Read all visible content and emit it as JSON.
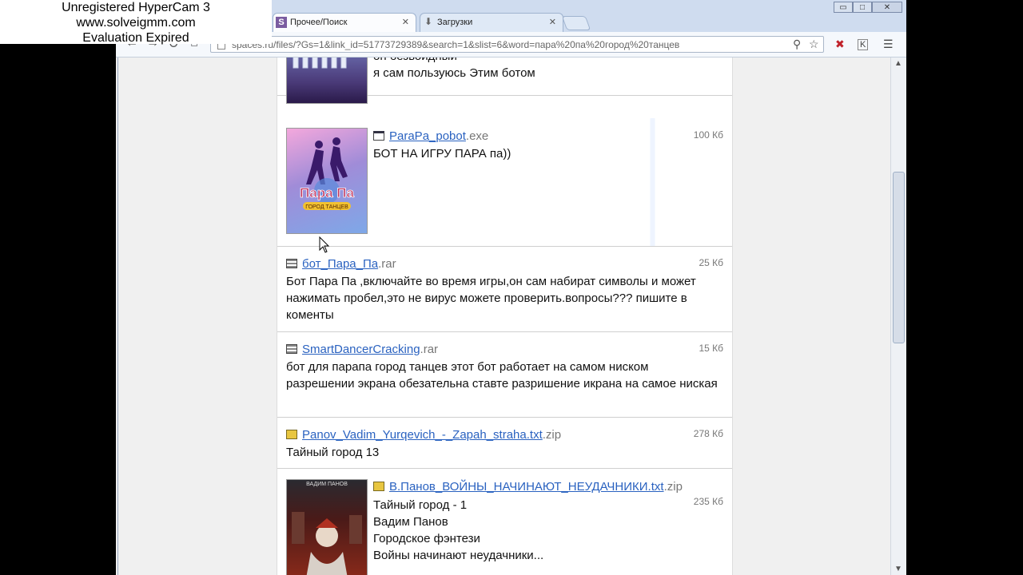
{
  "watermark": {
    "line1": "Unregistered HyperCam 3",
    "line2": "www.solveigmm.com",
    "line3": "Evaluation Expired"
  },
  "browser": {
    "tabs": [
      {
        "label": "Прочее/Поиск",
        "icon": "spaces-favicon",
        "active": true
      },
      {
        "label": "Загрузки",
        "icon": "download-icon",
        "active": false
      }
    ],
    "url": "spaces.ru/files/?Gs=1&link_id=51773729389&search=1&slist=6&word=пара%20па%20город%20танцев",
    "window_buttons": {
      "minimize": "▭",
      "maximize": "□",
      "close": "✕"
    }
  },
  "content": {
    "top_partial": {
      "line1": "он безвоидный",
      "line2": "я сам пользуюсь Этим ботом"
    },
    "entries": [
      {
        "icon": "window-icon",
        "name": "ParaPa_pobot",
        "ext": ".exe",
        "size": "100 Кб",
        "desc": "БОТ НА ИГРУ ПАРА па))"
      },
      {
        "icon": "rar-icon",
        "name": "бот_Пара_Па",
        "ext": ".rar",
        "size": "25 Кб",
        "desc": "Бот Пара Па ,включайте во время игры,он сам набират символы и может нажимать пробел,это не вирус можете проверить.вопросы??? пишите в коменты"
      },
      {
        "icon": "rar-icon",
        "name": "SmartDancerCracking",
        "ext": ".rar",
        "size": "15 Кб",
        "desc": "бот для парапа город танцев этот бот работает на самом ниском разрешении экрана обезательна ставте разришение икрана на самое ниская"
      },
      {
        "icon": "zip-icon",
        "name": "Panov_Vadim_Yurqevich_-_Zapah_straha.txt",
        "ext": ".zip",
        "size": "278 Кб",
        "desc": "Тайный город 13"
      },
      {
        "icon": "zip-icon",
        "name": "В.Панов_ВОЙНЫ_НАЧИНАЮТ_НЕУДАЧНИКИ.txt",
        "ext": ".zip",
        "size": "235 Кб",
        "desc_lines": [
          "Тайный город - 1",
          "Вадим Панов",
          "Городское фэнтези",
          "Войны начинают неудачники..."
        ]
      }
    ],
    "thumb_logo": {
      "line1": "Пара Па",
      "line2": "ГОРОД ТАНЦЕВ"
    },
    "book_author": "ВАДИМ ПАНОВ"
  },
  "colors": {
    "link": "#2a62c0",
    "frame": "#cfdcef"
  }
}
